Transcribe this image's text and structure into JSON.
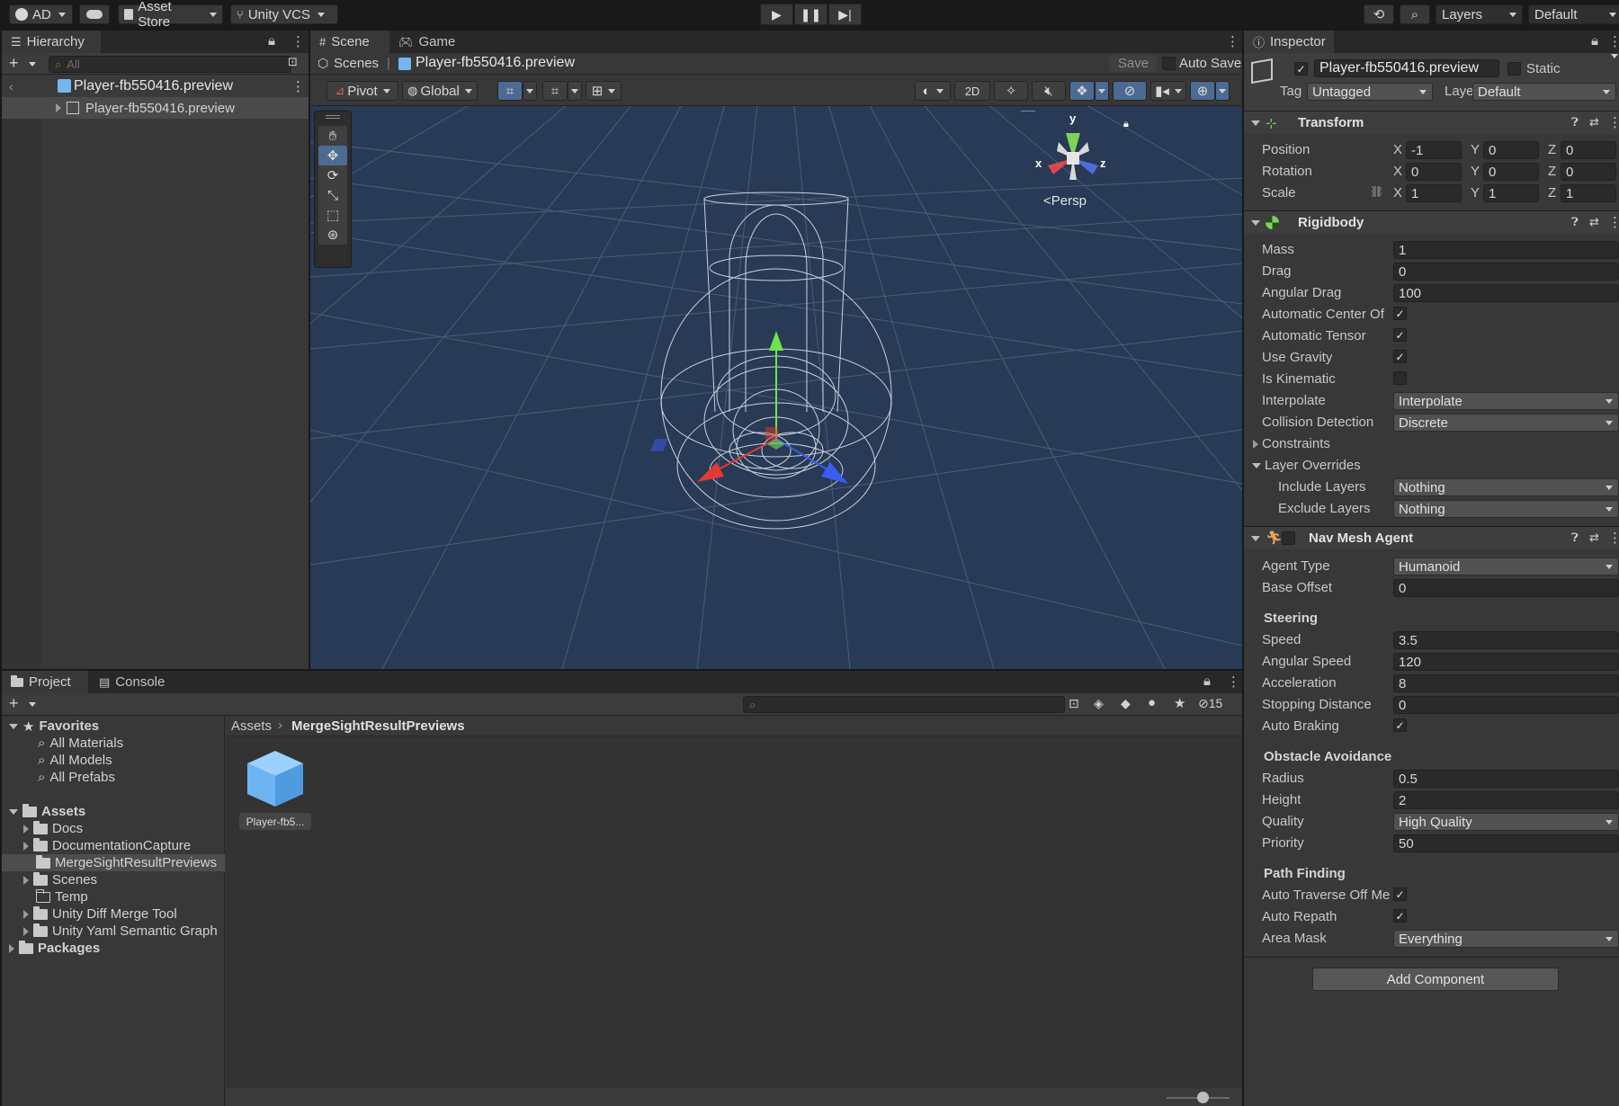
{
  "toolbar": {
    "account": "AD",
    "asset_store": "Asset Store",
    "vcs": "Unity VCS",
    "layers": "Layers",
    "layout": "Default"
  },
  "hierarchy": {
    "tab": "Hierarchy",
    "search_placeholder": "All",
    "scene_root": "Player-fb550416.preview",
    "child": "Player-fb550416.preview"
  },
  "scene": {
    "tab_scene": "Scene",
    "tab_game": "Game",
    "breadcrumb_scenes": "Scenes",
    "breadcrumb_item": "Player-fb550416.preview",
    "save": "Save",
    "auto_save": "Auto Save",
    "pivot": "Pivot",
    "global": "Global",
    "two_d": "2D",
    "persp": "Persp",
    "gizmo_y": "y",
    "gizmo_x": "x",
    "gizmo_z": "z"
  },
  "project": {
    "tab_project": "Project",
    "tab_console": "Console",
    "hidden_count": "15",
    "favorites": "Favorites",
    "fav_items": [
      "All Materials",
      "All Models",
      "All Prefabs"
    ],
    "assets": "Assets",
    "asset_folders": [
      "Docs",
      "DocumentationCapture",
      "MergeSightResultPreviews",
      "Scenes",
      "Temp",
      "Unity Diff Merge Tool",
      "Unity Yaml Semantic Graph"
    ],
    "packages": "Packages",
    "breadcrumb_root": "Assets",
    "breadcrumb_current": "MergeSightResultPreviews",
    "asset_item": "Player-fb5..."
  },
  "inspector": {
    "tab": "Inspector",
    "object_name": "Player-fb550416.preview",
    "static": "Static",
    "tag_label": "Tag",
    "tag_value": "Untagged",
    "layer_label": "Layer",
    "layer_value": "Default",
    "transform": {
      "title": "Transform",
      "position": "Position",
      "rotation": "Rotation",
      "scale": "Scale",
      "x": "X",
      "y": "Y",
      "z": "Z",
      "pos": [
        "-1",
        "0",
        "0"
      ],
      "rot": [
        "0",
        "0",
        "0"
      ],
      "scl": [
        "1",
        "1",
        "1"
      ]
    },
    "rigidbody": {
      "title": "Rigidbody",
      "mass_label": "Mass",
      "mass": "1",
      "drag_label": "Drag",
      "drag": "0",
      "angular_drag_label": "Angular Drag",
      "angular_drag": "100",
      "auto_center_label": "Automatic Center Of",
      "auto_tensor_label": "Automatic Tensor",
      "use_gravity_label": "Use Gravity",
      "is_kinematic_label": "Is Kinematic",
      "interpolate_label": "Interpolate",
      "interpolate": "Interpolate",
      "collision_label": "Collision Detection",
      "collision": "Discrete",
      "constraints_label": "Constraints",
      "layer_overrides_label": "Layer Overrides",
      "include_label": "Include Layers",
      "include": "Nothing",
      "exclude_label": "Exclude Layers",
      "exclude": "Nothing"
    },
    "navmesh": {
      "title": "Nav Mesh Agent",
      "agent_type_label": "Agent Type",
      "agent_type": "Humanoid",
      "base_offset_label": "Base Offset",
      "base_offset": "0",
      "steering": "Steering",
      "speed_label": "Speed",
      "speed": "3.5",
      "angular_speed_label": "Angular Speed",
      "angular_speed": "120",
      "acceleration_label": "Acceleration",
      "acceleration": "8",
      "stopping_label": "Stopping Distance",
      "stopping": "0",
      "auto_braking_label": "Auto Braking",
      "obstacle": "Obstacle Avoidance",
      "radius_label": "Radius",
      "radius": "0.5",
      "height_label": "Height",
      "height": "2",
      "quality_label": "Quality",
      "quality": "High Quality",
      "priority_label": "Priority",
      "priority": "50",
      "path_finding": "Path Finding",
      "auto_traverse_label": "Auto Traverse Off Me",
      "auto_repath_label": "Auto Repath",
      "area_mask_label": "Area Mask",
      "area_mask": "Everything"
    },
    "add_component": "Add Component"
  }
}
